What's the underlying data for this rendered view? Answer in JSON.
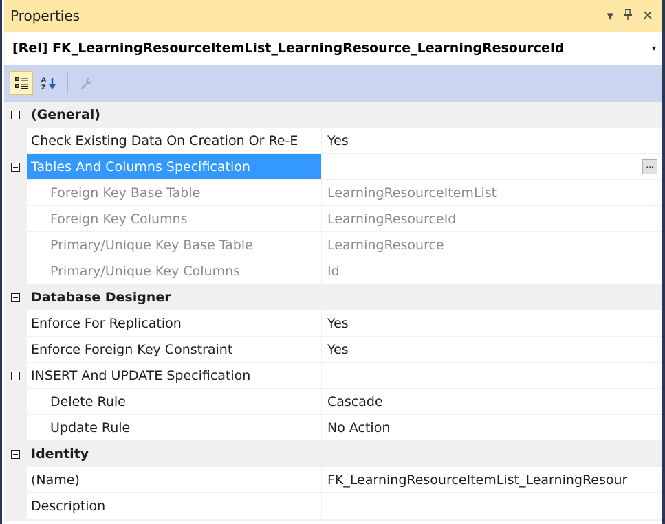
{
  "window": {
    "title": "Properties",
    "dropdown_glyph": "▾",
    "pin_glyph": "⊥",
    "close_glyph": "✕"
  },
  "object_selector": {
    "value": "[Rel] FK_LearningResourceItemList_LearningResource_LearningResourceId",
    "arrow": "▾"
  },
  "toolbar": {
    "buttons": [
      "categorized-icon",
      "alphabetical-icon",
      "property-pages-icon"
    ]
  },
  "grid": {
    "general": {
      "label": "(General)"
    },
    "check_existing": {
      "name": "Check Existing Data On Creation Or Re-E",
      "value": "Yes"
    },
    "tables_columns": {
      "name": "Tables And Columns Specification",
      "value": "",
      "button": "..."
    },
    "fk_base_table": {
      "name": "Foreign Key Base Table",
      "value": "LearningResourceItemList"
    },
    "fk_columns": {
      "name": "Foreign Key Columns",
      "value": "LearningResourceId"
    },
    "pk_base_table": {
      "name": "Primary/Unique Key Base Table",
      "value": "LearningResource"
    },
    "pk_columns": {
      "name": "Primary/Unique Key Columns",
      "value": "Id"
    },
    "database_designer": {
      "label": "Database Designer"
    },
    "enforce_replication": {
      "name": "Enforce For Replication",
      "value": "Yes"
    },
    "enforce_fk": {
      "name": "Enforce Foreign Key Constraint",
      "value": "Yes"
    },
    "insert_update": {
      "name": "INSERT And UPDATE Specification",
      "value": ""
    },
    "delete_rule": {
      "name": "Delete Rule",
      "value": "Cascade"
    },
    "update_rule": {
      "name": "Update Rule",
      "value": "No Action"
    },
    "identity": {
      "label": "Identity"
    },
    "name_prop": {
      "name": "(Name)",
      "value": "FK_LearningResourceItemList_LearningResour"
    },
    "description": {
      "name": "Description",
      "value": ""
    }
  },
  "colors": {
    "title_bg": "#ffe8a6",
    "toolbar_bg": "#ccd5f0",
    "selection": "#3399ff",
    "frame": "#293955"
  }
}
